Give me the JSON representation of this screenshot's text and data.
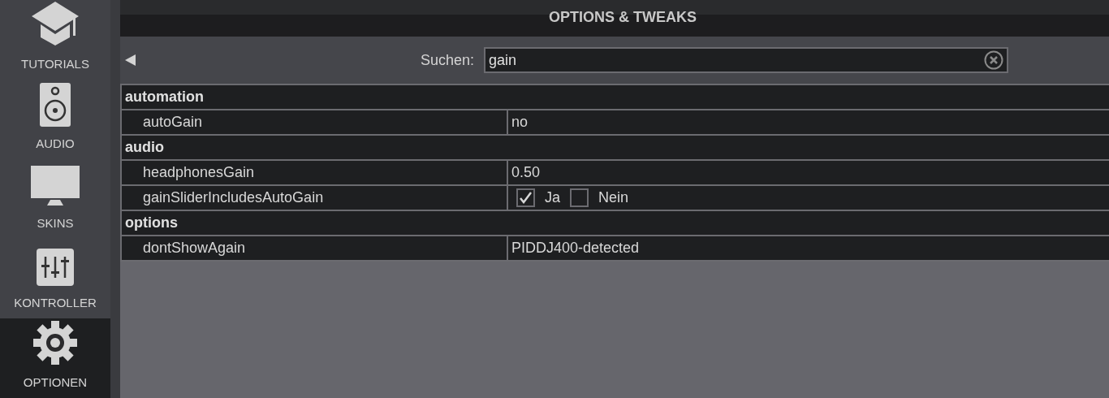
{
  "sidebar": {
    "items": [
      {
        "label": "TUTORIALS",
        "selected": false
      },
      {
        "label": "AUDIO",
        "selected": false
      },
      {
        "label": "SKINS",
        "selected": false
      },
      {
        "label": "KONTROLLER",
        "selected": false
      },
      {
        "label": "OPTIONEN",
        "selected": true
      }
    ]
  },
  "title": "OPTIONS & TWEAKS",
  "search": {
    "label": "Suchen:",
    "value": "gain"
  },
  "rows": [
    {
      "kind": "group",
      "label": "automation"
    },
    {
      "kind": "text",
      "label": "autoGain",
      "value": "no"
    },
    {
      "kind": "group",
      "label": "audio"
    },
    {
      "kind": "text",
      "label": "headphonesGain",
      "value": "0.50"
    },
    {
      "kind": "choice",
      "label": "gainSliderIncludesAutoGain",
      "options": [
        {
          "label": "Ja",
          "checked": true
        },
        {
          "label": "Nein",
          "checked": false
        }
      ]
    },
    {
      "kind": "group",
      "label": "options"
    },
    {
      "kind": "text",
      "label": "dontShowAgain",
      "value": "PIDDJ400-detected"
    }
  ]
}
